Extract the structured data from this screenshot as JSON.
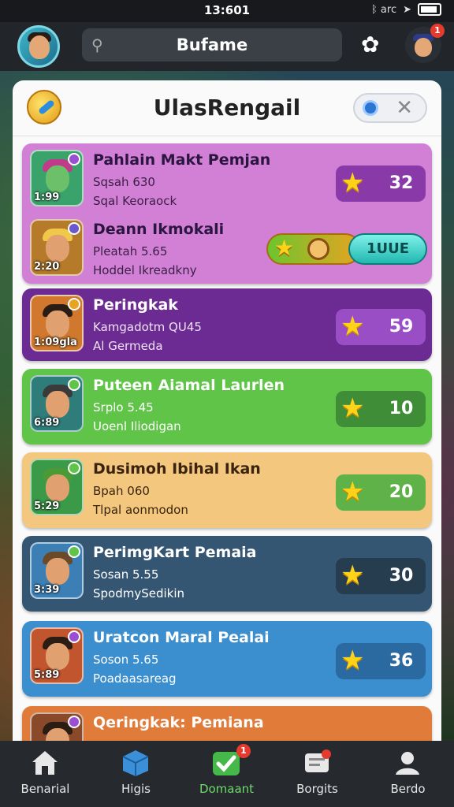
{
  "status_bar": {
    "time": "13:601",
    "icons_text": "ᛒ arc"
  },
  "top_bar": {
    "search_text": "Bufame",
    "notification_count": "1"
  },
  "panel": {
    "title": "UlasRengail"
  },
  "entries": [
    {
      "name": "Pahlain Makt Pemjan",
      "line1": "Sqsah 630",
      "line2": "Sqal Keoraock",
      "avatar_score": "1:99",
      "points": "32",
      "colors": {
        "card": "#d27fd6",
        "pill": "#8a3aa8"
      }
    },
    {
      "name": "Deann Ikmokali",
      "line1": "Pleatah 5.65",
      "line2": "Hoddel Ikreadkny",
      "avatar_score": "2:20",
      "action_label": "1UUE"
    },
    {
      "name": "Peringkak",
      "line1": "Kamgadotm QU45",
      "line2": "Al Germeda",
      "avatar_score": "1:09gla",
      "points": "59",
      "colors": {
        "card": "#6c2a93",
        "pill": "#9a4ec6"
      }
    },
    {
      "name": "Puteen Aiamal Laurlen",
      "line1": "Srplo 5.45",
      "line2": "Uoenl Iliodigan",
      "avatar_score": "6:89",
      "points": "10",
      "colors": {
        "card": "#5fc447",
        "pill": "#3f8d37"
      }
    },
    {
      "name": "Dusimoh Ibihal Ikan",
      "line1": "Bpah 060",
      "line2": "Tlpal aonmodon",
      "avatar_score": "5:29",
      "points": "20",
      "colors": {
        "card": "#f4c77e",
        "pill": "#5fb248"
      }
    },
    {
      "name": "PerimgKart Pemaia",
      "line1": "Sosan 5.55",
      "line2": "SpodmySedikin",
      "avatar_score": "3:39",
      "points": "30",
      "colors": {
        "card": "#355673",
        "pill": "#263d50"
      }
    },
    {
      "name": "Uratcon Maral Pealai",
      "line1": "Soson 5.65",
      "line2": "Poadaasareag",
      "avatar_score": "5:89",
      "points": "36",
      "colors": {
        "card": "#3c8fcf",
        "pill": "#2a6aa0"
      }
    },
    {
      "name": "Qeringkak: Pemiana",
      "colors": {
        "card": "#e07b3a"
      }
    }
  ],
  "tab_bar": {
    "items": [
      {
        "label": "Benarial",
        "icon": "home-icon"
      },
      {
        "label": "Higis",
        "icon": "box-icon"
      },
      {
        "label": "Domaant",
        "icon": "check-icon",
        "badge": "1"
      },
      {
        "label": "Borgits",
        "icon": "chat-icon"
      },
      {
        "label": "Berdo",
        "icon": "profile-icon"
      }
    ],
    "active_index": 2
  }
}
